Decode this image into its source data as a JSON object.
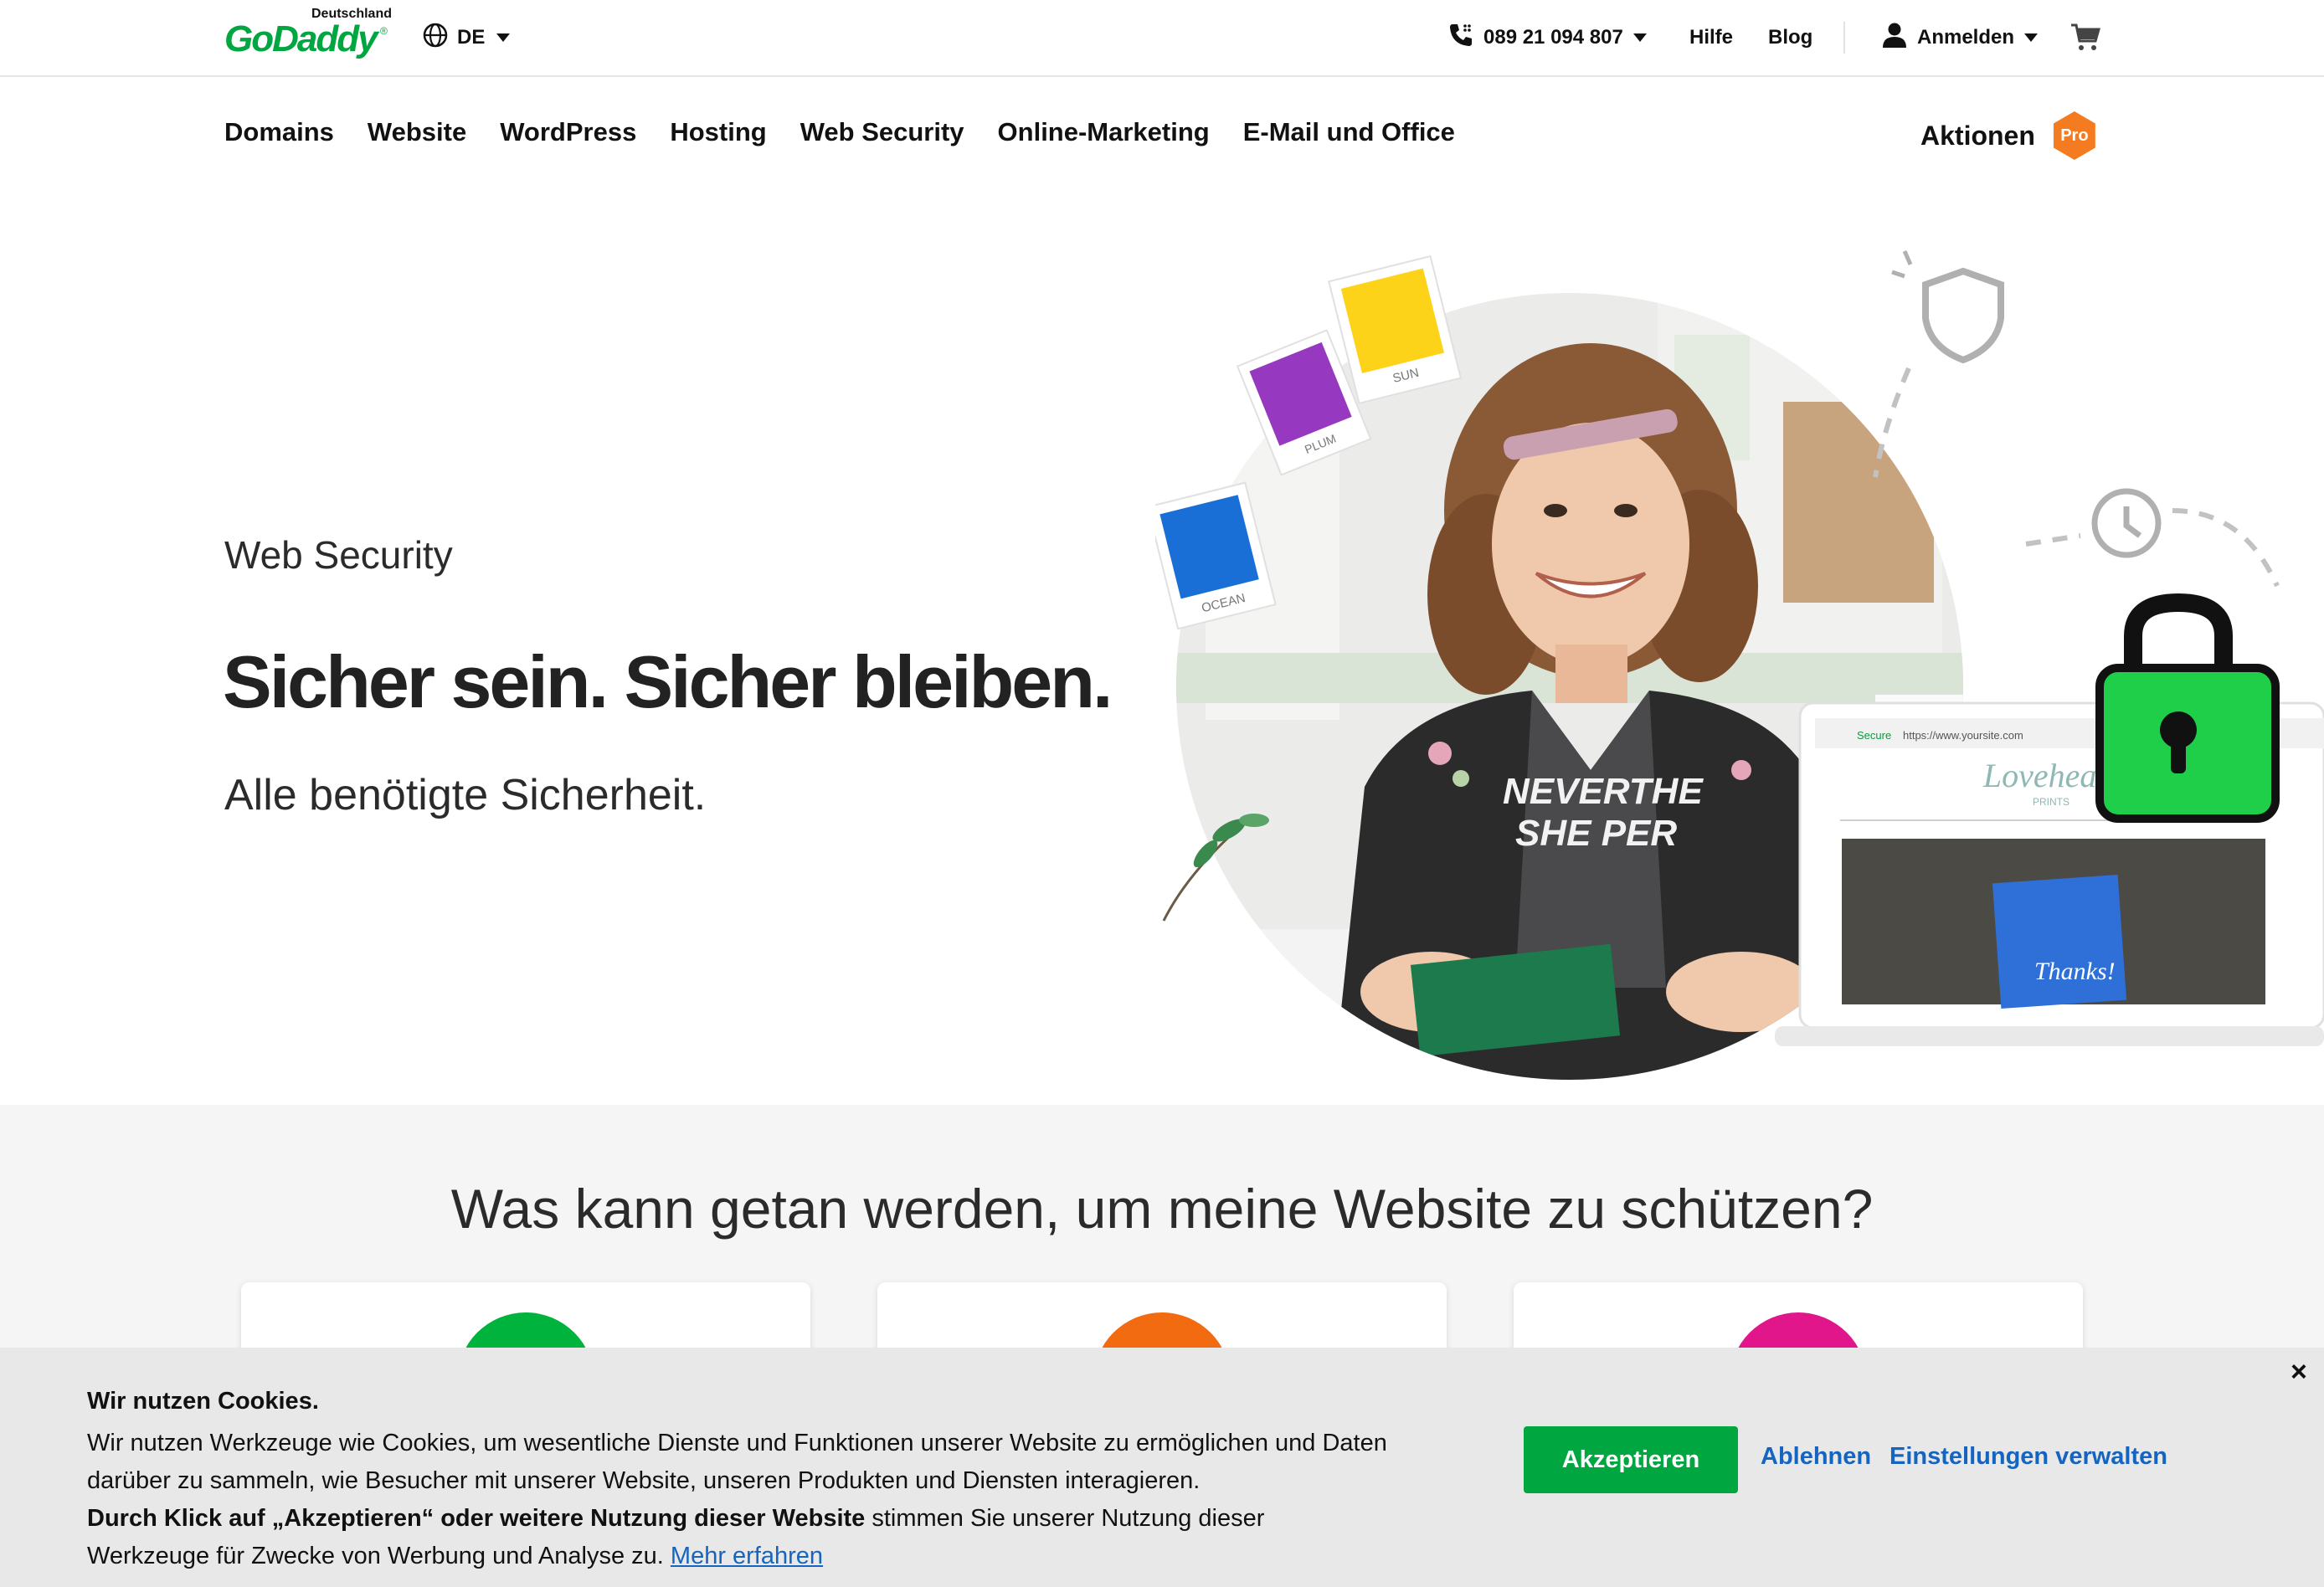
{
  "header": {
    "logo_region": "Deutschland",
    "logo_word": "GoDaddy",
    "lang": "DE",
    "phone": "089 21 094 807",
    "help": "Hilfe",
    "blog": "Blog",
    "signin": "Anmelden"
  },
  "nav": {
    "items": [
      "Domains",
      "Website",
      "WordPress",
      "Hosting",
      "Web Security",
      "Online-Marketing",
      "E-Mail und Office"
    ],
    "promo": "Aktionen",
    "pro_badge": "Pro"
  },
  "hero": {
    "eyebrow": "Web Security",
    "title": "Sicher sein. Sicher bleiben.",
    "subtitle": "Alle benötigte Sicherheit.",
    "swatches": [
      "OCEAN",
      "PLUM",
      "SUN"
    ],
    "laptop_brand": "Loveheart",
    "laptop_brand_sub": "PRINTS",
    "laptop_url": "https://www.yoursite.com",
    "laptop_secure": "Secure",
    "card_text": "Thanks!",
    "shirt_text": "NEVERTHELESS SHE PERSISTED"
  },
  "section": {
    "title": "Was kann getan werden, um meine Website zu schützen?",
    "cards": [
      "green",
      "orange",
      "magenta"
    ]
  },
  "colors": {
    "brand_green": "#00a63f",
    "pro_orange": "#f47b20",
    "link_blue": "#1565c0",
    "lock_green": "#1fcf4a",
    "card_green": "#00b33c",
    "card_orange": "#f26b10",
    "card_magenta": "#e0168a"
  },
  "cookie": {
    "title": "Wir nutzen Cookies.",
    "line1": "Wir nutzen Werkzeuge wie Cookies, um wesentliche Dienste und Funktionen unserer Website zu ermöglichen und Daten darüber zu sammeln, wie Besucher mit unserer Website, unseren Produkten und Diensten interagieren.",
    "bold": "Durch Klick auf „Akzeptieren“ oder weitere Nutzung dieser Website",
    "line2": " stimmen Sie unserer Nutzung dieser Werkzeuge für Zwecke von Werbung und Analyse zu. ",
    "more": "Mehr erfahren",
    "accept": "Akzeptieren",
    "decline": "Ablehnen",
    "settings": "Einstellungen verwalten",
    "close": "×"
  }
}
